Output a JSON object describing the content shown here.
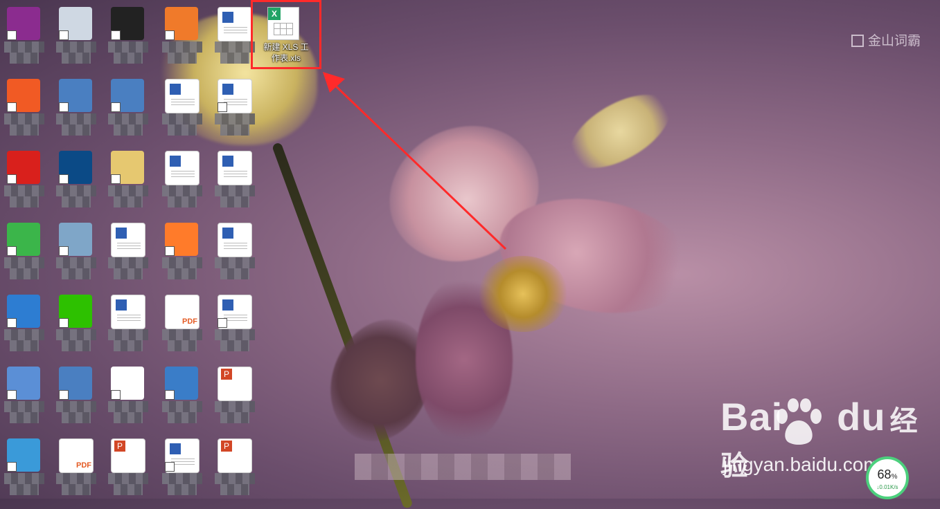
{
  "selected_file": {
    "label_line1": "新建 XLS 工",
    "label_line2": "作表.xls",
    "badge": "X"
  },
  "desktop_icons": [
    {
      "name": "winrar-icon"
    },
    {
      "name": "recycle-bin-icon"
    },
    {
      "name": "qq-icon"
    },
    {
      "name": "pdf-editor-icon"
    },
    {
      "name": "word-doc-icon"
    },
    {
      "name": "wps-office-icon"
    },
    {
      "name": "app-icon"
    },
    {
      "name": "app-icon"
    },
    {
      "name": "word-doc-icon"
    },
    {
      "name": "word-doc-icon"
    },
    {
      "name": "youdao-icon"
    },
    {
      "name": "photoshop-icon"
    },
    {
      "name": "folder-icon"
    },
    {
      "name": "word-doc-icon"
    },
    {
      "name": "word-doc-icon"
    },
    {
      "name": "360-icon"
    },
    {
      "name": "network-icon"
    },
    {
      "name": "word-doc-icon"
    },
    {
      "name": "firefox-icon"
    },
    {
      "name": "word-doc-icon"
    },
    {
      "name": "app-13-icon"
    },
    {
      "name": "wechat-icon"
    },
    {
      "name": "word-doc-icon"
    },
    {
      "name": "pdf-doc-icon"
    },
    {
      "name": "word-doc-icon"
    },
    {
      "name": "computer-icon"
    },
    {
      "name": "app-icon"
    },
    {
      "name": "baidu-netdisk-icon"
    },
    {
      "name": "math-icon"
    },
    {
      "name": "ppt-doc-icon"
    },
    {
      "name": "globe-icon"
    },
    {
      "name": "pdf-doc-icon"
    },
    {
      "name": "ppt-doc-icon"
    },
    {
      "name": "word-doc-icon"
    },
    {
      "name": "ppt-doc-icon"
    }
  ],
  "watermark_top": "金山词霸",
  "watermark_baidu": {
    "brand": "Bai",
    "brand2": "du",
    "cn": "经验",
    "url": "jingyan.baidu.com"
  },
  "net_widget": {
    "percent": "68",
    "percent_sign": "%",
    "speed": "↓0.01K/s"
  },
  "colors": {
    "highlight": "#ff2a2a",
    "excel": "#21a366"
  }
}
